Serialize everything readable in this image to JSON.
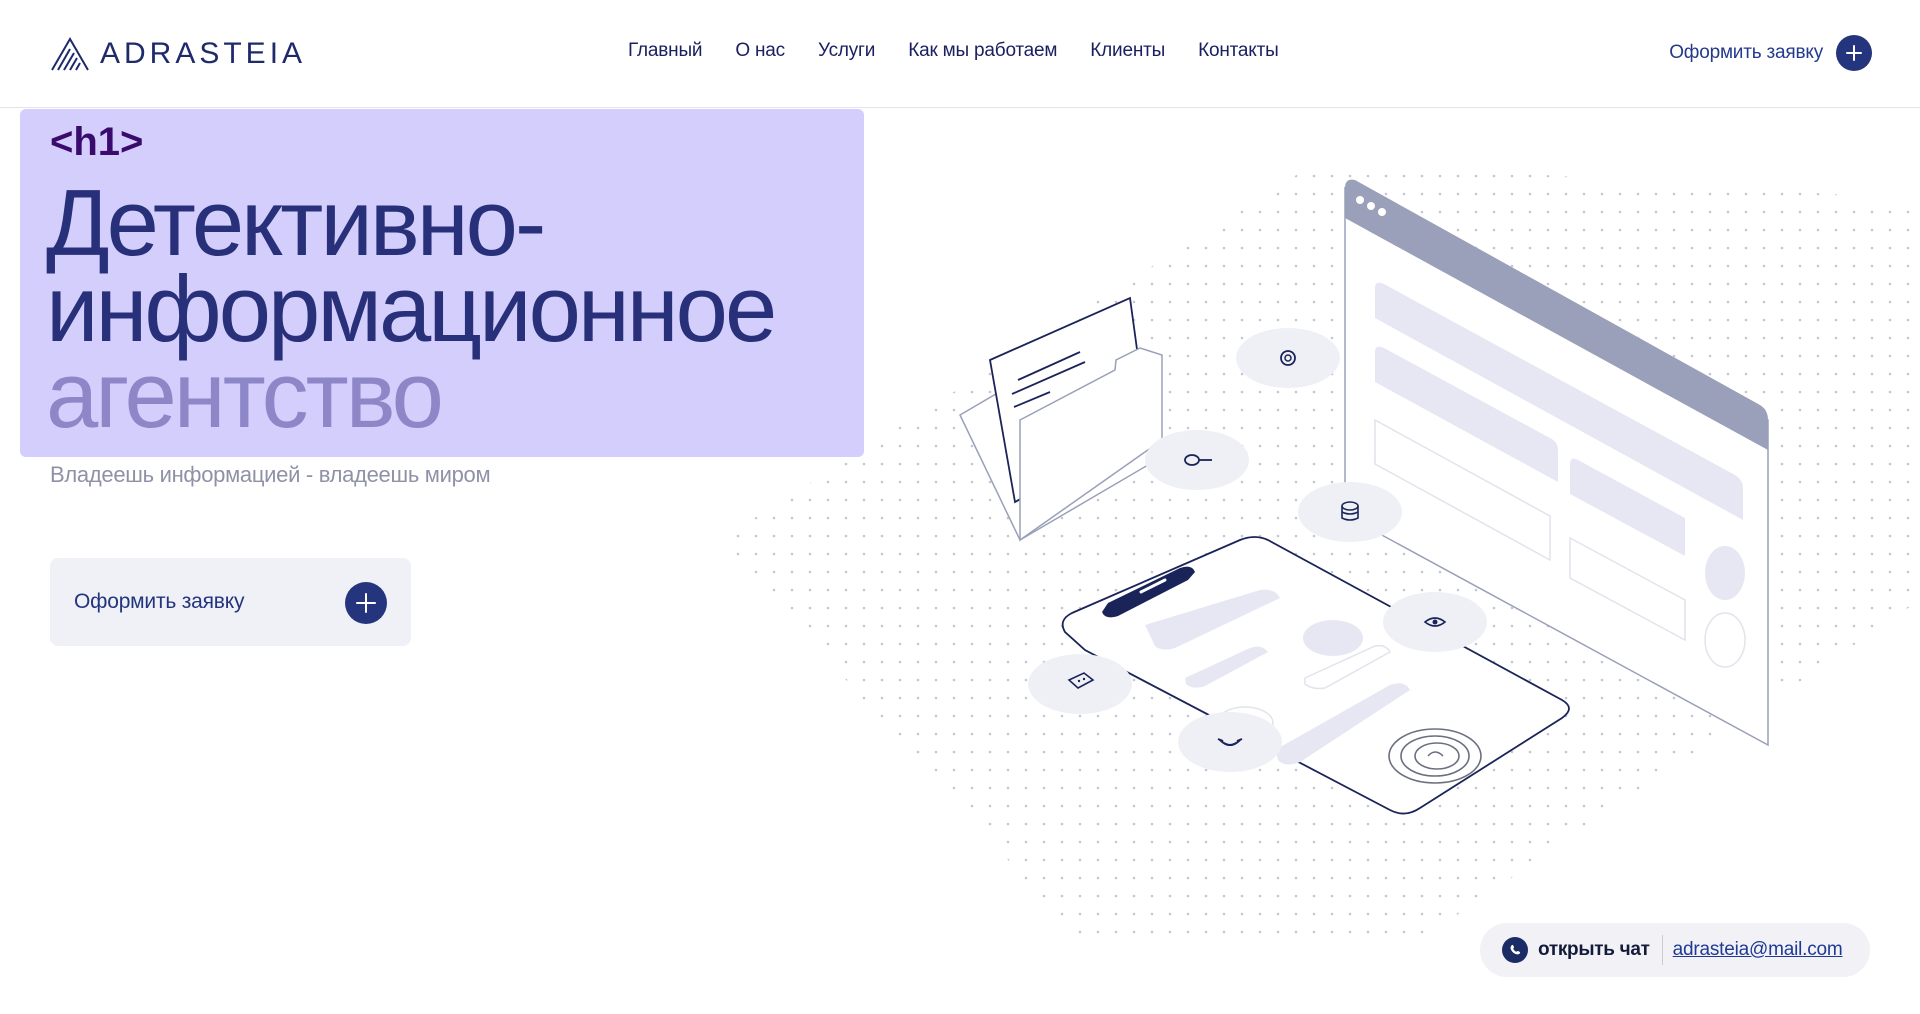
{
  "header": {
    "logo_text": "ADRASTEIA",
    "nav": [
      {
        "label": "Главный"
      },
      {
        "label": "О нас"
      },
      {
        "label": "Услуги"
      },
      {
        "label": "Как мы работаем"
      },
      {
        "label": "Клиенты"
      },
      {
        "label": "Контакты"
      }
    ],
    "cta_label": "Оформить заявку"
  },
  "hero": {
    "tag": "<h1>",
    "title_line1": "Детективно-",
    "title_line2": "информационное",
    "title_line3": "агентство",
    "subtitle": "Владеешь информацией - владеешь миром",
    "cta_label": "Оформить заявку"
  },
  "chat": {
    "open_label": "открыть чат",
    "email": "adrasteia@mail.com"
  },
  "colors": {
    "brand_dark": "#1f2a6b",
    "hero_bg": "#d4cefd",
    "accent_button": "#25357d",
    "title_light": "#8d87c8"
  },
  "icons": [
    "logo-mark-icon",
    "plus-icon",
    "whatsapp-icon",
    "email-at-icon",
    "key-icon",
    "database-icon",
    "eye-icon",
    "message-icon",
    "phone-icon",
    "fingerprint-icon"
  ]
}
